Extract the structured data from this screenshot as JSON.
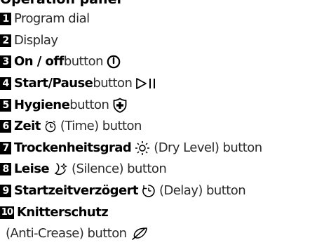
{
  "heading": "Operation panel",
  "items": [
    {
      "num": "1",
      "label": "Program dial"
    },
    {
      "num": "2",
      "label": "Display"
    },
    {
      "num": "3",
      "bold": "On / off",
      "rest": " button",
      "icon": "power-icon"
    },
    {
      "num": "4",
      "bold": "Start/Pause",
      "rest": " button",
      "icon": "start-pause-icon"
    },
    {
      "num": "5",
      "bold": "Hygiene",
      "rest": " button",
      "icon": "hygiene-shield-icon"
    },
    {
      "num": "6",
      "bold": "Zeit",
      "rest": " (Time) button",
      "icon": "clock-icon"
    },
    {
      "num": "7",
      "bold": "Trockenheitsgrad",
      "rest": " (Dry Level) button",
      "icon": "sun-icon"
    },
    {
      "num": "8",
      "bold": "Leise",
      "rest": "(Silence) button",
      "icon": "moon-icon"
    },
    {
      "num": "9",
      "bold": "Startzeitverzögert",
      "rest": "(Delay) button",
      "icon": "delay-clock-icon"
    },
    {
      "num": "10",
      "bold": "Knitterschutz",
      "rest": "(Anti-Crease) button",
      "icon": "feather-icon"
    }
  ]
}
